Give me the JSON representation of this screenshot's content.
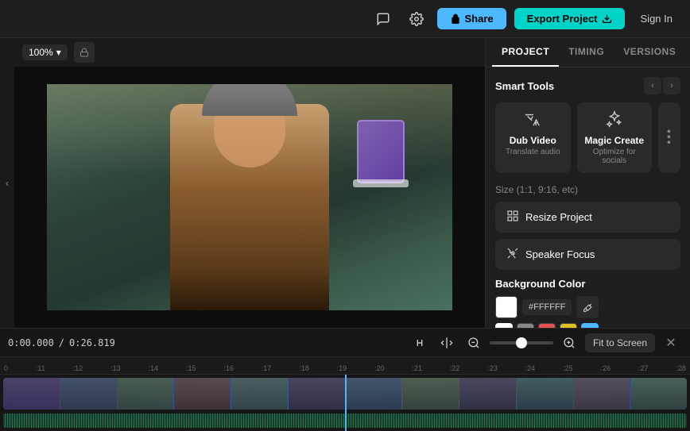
{
  "topbar": {
    "share_label": "Share",
    "export_label": "Export Project",
    "signin_label": "Sign In"
  },
  "video_toolbar": {
    "zoom": "100%",
    "zoom_chevron": "▾"
  },
  "panel": {
    "tabs": [
      {
        "id": "project",
        "label": "PROJECT",
        "active": true
      },
      {
        "id": "timing",
        "label": "TIMING",
        "active": false
      },
      {
        "id": "versions",
        "label": "VERSIONS",
        "active": false
      }
    ],
    "smart_tools_title": "Smart Tools",
    "tools": [
      {
        "id": "dub-video",
        "name": "Dub Video",
        "desc": "Translate audio"
      },
      {
        "id": "magic-create",
        "name": "Magic Create",
        "desc": "Optimize for socials"
      }
    ],
    "size_section_label": "Size (1:1, 9:16, etc)",
    "resize_btn": "Resize Project",
    "speaker_focus_btn": "Speaker Focus",
    "bg_color_section_label": "Background Color",
    "color_hex": "#FFFFFF",
    "color_presets": [
      {
        "color": "#FFFFFF"
      },
      {
        "color": "#888888"
      },
      {
        "color": "#e05050"
      },
      {
        "color": "#e0c020"
      }
    ],
    "color_preset_blue": "#4db8ff"
  },
  "timeline": {
    "time_current": "0:00.000",
    "time_total": "0:26.819",
    "time_separator": "/",
    "fit_screen_label": "Fit to Screen",
    "ruler_marks": [
      "0",
      ":11",
      ":12",
      ":13",
      ":14",
      ":15",
      ":16",
      ":17",
      ":18",
      ":19",
      ":20",
      ":21",
      ":22",
      ":23",
      ":24",
      ":25",
      ":26",
      ":27",
      ":28"
    ]
  }
}
